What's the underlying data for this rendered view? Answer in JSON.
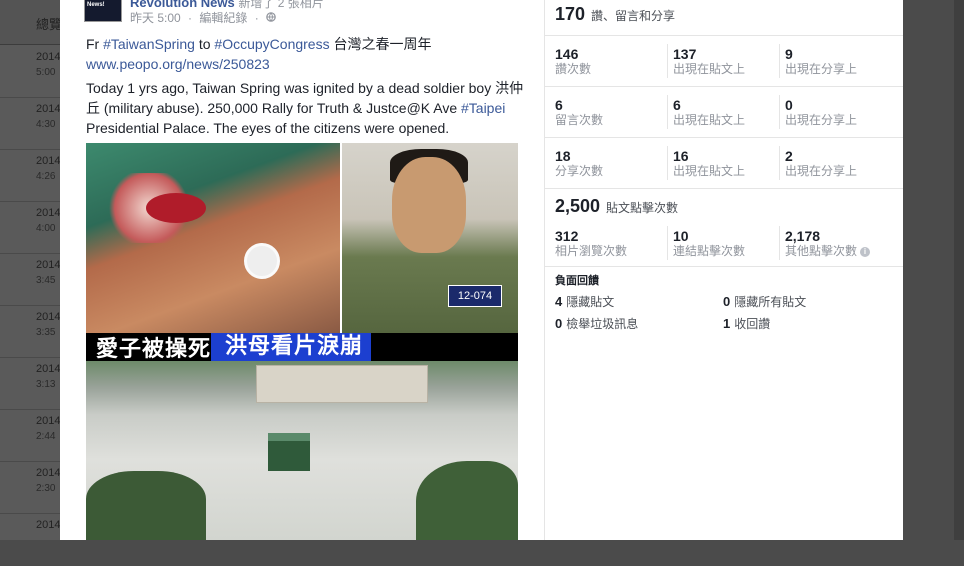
{
  "background": {
    "header": "總覽",
    "rows": [
      {
        "date": "2014",
        "time": "5:00"
      },
      {
        "date": "2014",
        "time": "4:30"
      },
      {
        "date": "2014",
        "time": "4:26"
      },
      {
        "date": "2014",
        "time": "4:00"
      },
      {
        "date": "2014",
        "time": "3:45"
      },
      {
        "date": "2014",
        "time": "3:35"
      },
      {
        "date": "2014",
        "time": "3:13"
      },
      {
        "date": "2014",
        "time": "2:44"
      },
      {
        "date": "2014",
        "time": "2:30"
      },
      {
        "date": "2014",
        "time": ""
      }
    ]
  },
  "post": {
    "avatar_text": "Revolution News!",
    "page_name": "Revolution News",
    "page_name_suffix": "新增了 2 張相片",
    "time": "昨天 5:00",
    "edit_history": "編輯紀錄",
    "line1_prefix": "Fr ",
    "line1_tag1": "#TaiwanSpring",
    "line1_mid": " to ",
    "line1_tag2": "#OccupyCongress",
    "line1_suffix": " 台灣之春一周年",
    "link": "www.peopo.org/news/250823",
    "para2_a": "Today 1 yrs ago, Taiwan Spring was ignited by a dead soldier boy 洪仲丘 (military abuse). 250,000 Rally for Truth & Justce@K Ave ",
    "para2_tag": "#Taipei",
    "para2_b": " Presidential Palace. The eyes of the citizens were opened.",
    "photo_badge": "12-074",
    "photo_caption_left": "愛子被操死",
    "photo_caption_right": "洪母看片淚崩"
  },
  "stats": {
    "total": "170",
    "total_label": "讚、留言和分享",
    "rows": [
      {
        "cells": [
          {
            "num": "146",
            "label": "讚次數"
          },
          {
            "num": "137",
            "label": "出現在貼文上"
          },
          {
            "num": "9",
            "label": "出現在分享上"
          }
        ]
      },
      {
        "cells": [
          {
            "num": "6",
            "label": "留言次數"
          },
          {
            "num": "6",
            "label": "出現在貼文上"
          },
          {
            "num": "0",
            "label": "出現在分享上"
          }
        ]
      },
      {
        "cells": [
          {
            "num": "18",
            "label": "分享次數"
          },
          {
            "num": "16",
            "label": "出現在貼文上"
          },
          {
            "num": "2",
            "label": "出現在分享上"
          }
        ]
      }
    ],
    "clicks_total": "2,500",
    "clicks_label": "貼文點擊次數",
    "click_cells": [
      {
        "num": "312",
        "label": "相片瀏覽次數"
      },
      {
        "num": "10",
        "label": "連結點擊次數"
      },
      {
        "num": "2,178",
        "label": "其他點擊次數"
      }
    ],
    "info_glyph": "i",
    "negative_title": "負面回饋",
    "negative": [
      {
        "num": "4",
        "label": "隱藏貼文"
      },
      {
        "num": "0",
        "label": "隱藏所有貼文"
      },
      {
        "num": "0",
        "label": "檢舉垃圾訊息"
      },
      {
        "num": "1",
        "label": "收回讚"
      }
    ]
  }
}
